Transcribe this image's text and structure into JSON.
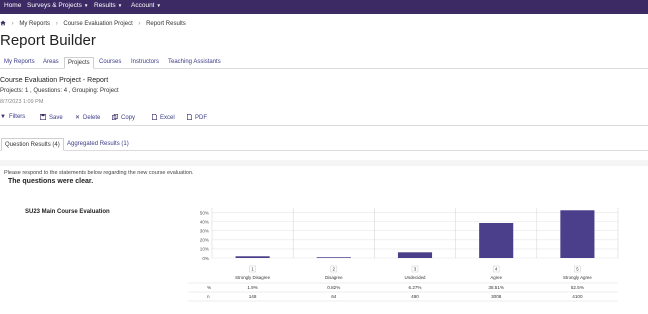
{
  "nav": {
    "home": "Home",
    "surveys": "Surveys & Projects",
    "results": "Results",
    "account": "Account"
  },
  "breadcrumb": {
    "home_icon": "home-icon",
    "items": [
      "My Reports",
      "Course Evaluation Project",
      "Report Results"
    ]
  },
  "page": {
    "title": "Report Builder"
  },
  "tabs": [
    "My Reports",
    "Areas",
    "Projects",
    "Courses",
    "Instructors",
    "Teaching Assistants"
  ],
  "active_tab": "Projects",
  "report": {
    "title": "Course Evaluation Project - Report",
    "meta": "Projects: 1 , Questions: 4 , Grouping: Project",
    "date": "8/7/2023 1:09 PM"
  },
  "toolbar": {
    "filters": "Filters",
    "save": "Save",
    "delete": "Delete",
    "copy": "Copy",
    "excel": "Excel",
    "pdf": "PDF"
  },
  "subtabs": [
    "Question Results (4)",
    "Aggregated Results (1)"
  ],
  "question": {
    "instruction": "Please respond to the statements below regarding the new course evaluation.",
    "text": "The questions were clear.",
    "survey": "SU23 Main Course Evaluation"
  },
  "colors": {
    "nav": "#3b2a63",
    "bar": "#4b3f8c",
    "link": "#3b3b8a"
  },
  "chart_data": {
    "type": "bar",
    "categories": [
      "Strongly Disagree",
      "Disagree",
      "Undecided",
      "Agree",
      "Strongly Agree"
    ],
    "category_numbers": [
      "1",
      "2",
      "3",
      "4",
      "5"
    ],
    "values": [
      1.9,
      0.82,
      6.27,
      38.51,
      52.5
    ],
    "yticks": [
      "0%",
      "10%",
      "20%",
      "30%",
      "40%",
      "50%"
    ],
    "ylim": [
      0,
      55
    ],
    "grid": true,
    "table": {
      "percent_label": "%",
      "count_label": "n",
      "percents": [
        "1.9%",
        "0.82%",
        "6.27%",
        "38.51%",
        "52.5%"
      ],
      "counts": [
        "148",
        "64",
        "490",
        "3008",
        "4100"
      ]
    }
  }
}
